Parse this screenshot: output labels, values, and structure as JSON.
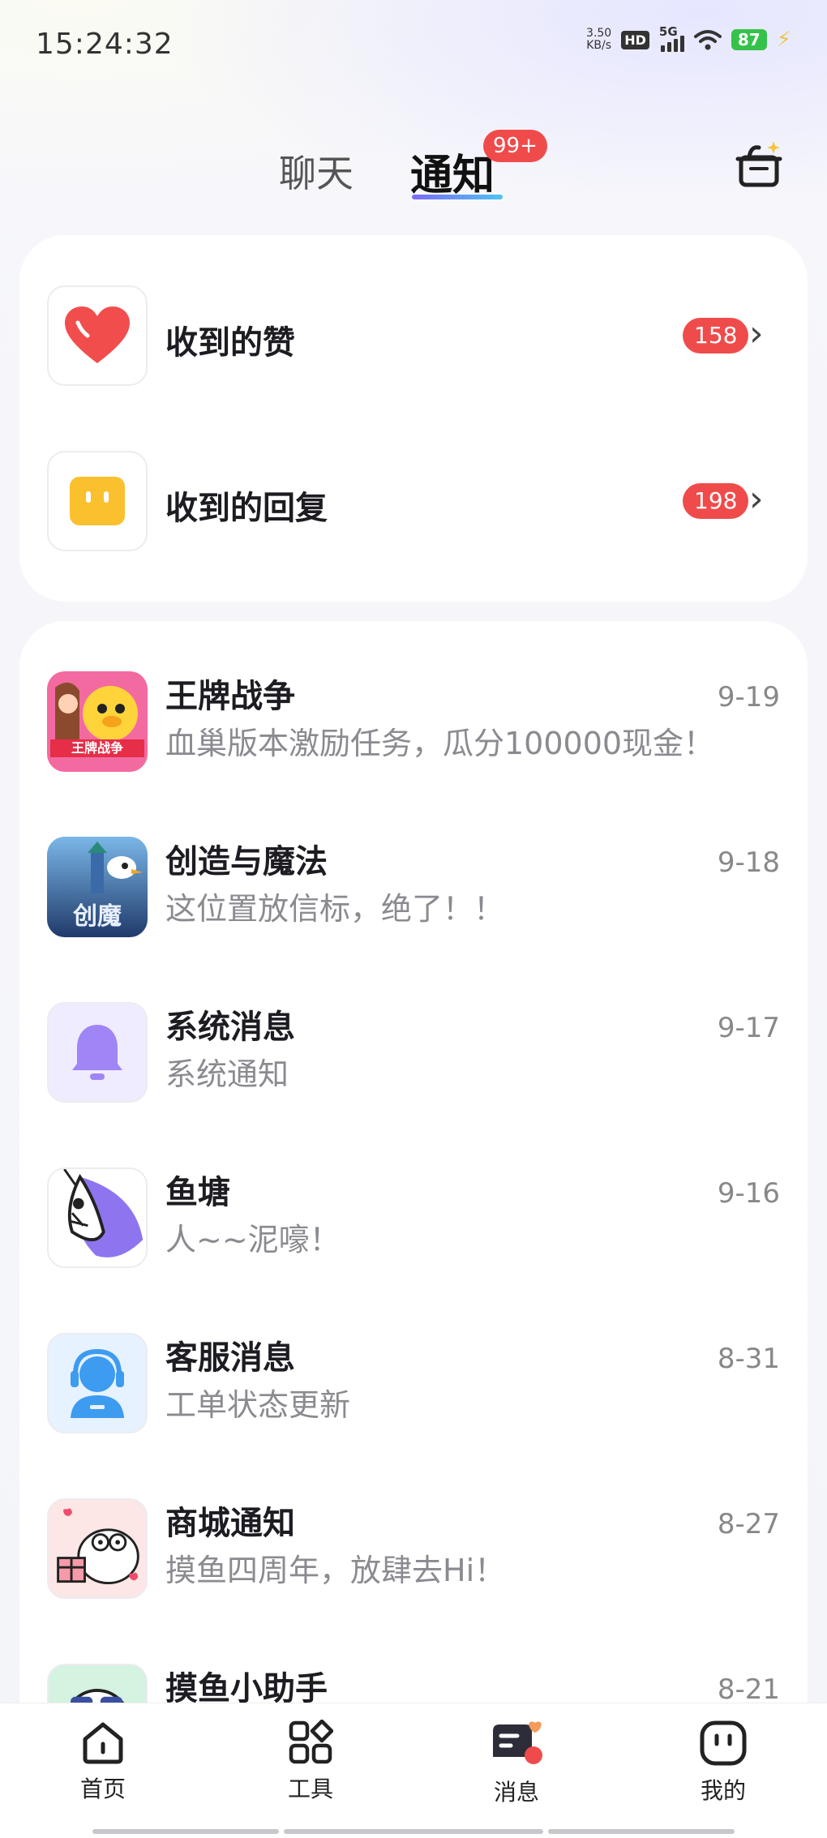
{
  "status_bar": {
    "time": "15:24:32",
    "net_speed_value": "3.50",
    "net_speed_unit": "KB/s",
    "hd_label": "HD",
    "network_label": "5G",
    "battery": "87"
  },
  "tabs": {
    "chat_label": "聊天",
    "notify_label": "通知",
    "notify_badge": "99+",
    "active": "通知"
  },
  "summary": [
    {
      "title": "收到的赞",
      "count": "158",
      "icon": "heart-icon"
    },
    {
      "title": "收到的回复",
      "count": "198",
      "icon": "reply-icon"
    }
  ],
  "notifications": [
    {
      "title": "王牌战争",
      "subtitle": "血巢版本激励任务，瓜分100000现金！",
      "date": "9-19",
      "icon": "game-wangpai-icon"
    },
    {
      "title": "创造与魔法",
      "subtitle": "这位置放信标，绝了！！",
      "date": "9-18",
      "icon": "game-chuangmo-icon"
    },
    {
      "title": "系统消息",
      "subtitle": "系统通知",
      "date": "9-17",
      "icon": "bell-icon"
    },
    {
      "title": "鱼塘",
      "subtitle": "人~~泥嚎！",
      "date": "9-16",
      "icon": "fish-icon"
    },
    {
      "title": "客服消息",
      "subtitle": "工单状态更新",
      "date": "8-31",
      "icon": "customer-service-icon"
    },
    {
      "title": "商城通知",
      "subtitle": "摸鱼四周年，放肆去Hi！",
      "date": "8-27",
      "icon": "mall-icon"
    },
    {
      "title": "摸鱼小助手",
      "subtitle": "",
      "date": "8-21",
      "icon": "assistant-icon"
    }
  ],
  "bottom_nav": [
    {
      "label": "首页",
      "icon": "home-icon"
    },
    {
      "label": "工具",
      "icon": "tools-icon"
    },
    {
      "label": "消息",
      "icon": "message-icon",
      "active": true
    },
    {
      "label": "我的",
      "icon": "profile-icon"
    }
  ],
  "colors": {
    "badge_red": "#f04b4b",
    "heart_red": "#f24d4d",
    "reply_yellow": "#fbc02d",
    "bell_purple": "#9f85f5",
    "service_blue": "#3d9bf0",
    "tab_underline_start": "#7b6cf5",
    "tab_underline_end": "#4ec3f0"
  }
}
